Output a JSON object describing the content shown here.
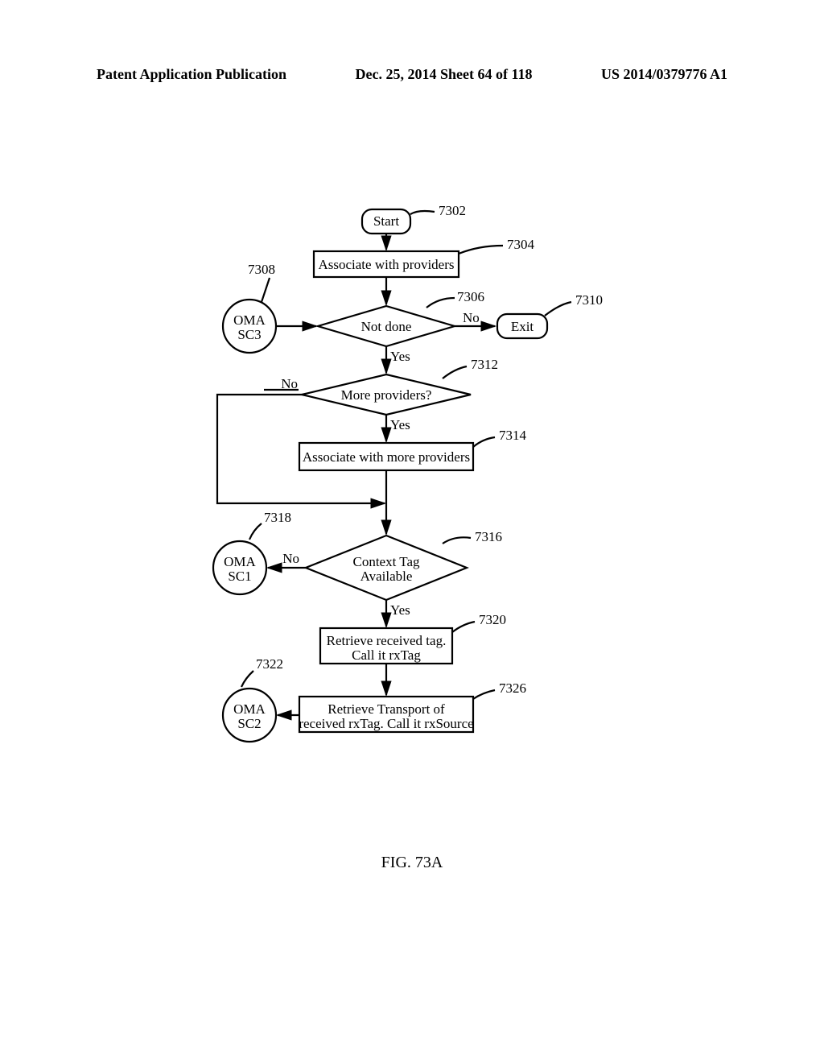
{
  "header": {
    "left": "Patent Application Publication",
    "center": "Dec. 25, 2014  Sheet 64 of 118",
    "right": "US 2014/0379776 A1"
  },
  "figure": {
    "caption": "FIG. 73A"
  },
  "nodes": {
    "start": {
      "label": "Start",
      "ref": "7302"
    },
    "assoc": {
      "label": "Associate with providers",
      "ref": "7304"
    },
    "oma_sc3": {
      "line1": "OMA",
      "line2": "SC3",
      "ref": "7308"
    },
    "notdone": {
      "label": "Not done",
      "ref": "7306",
      "yes": "Yes",
      "no": "No"
    },
    "exit": {
      "label": "Exit",
      "ref": "7310"
    },
    "more": {
      "label": "More providers?",
      "ref": "7312",
      "yes": "Yes",
      "no": "No"
    },
    "assoc_more": {
      "label": "Associate with more providers",
      "ref": "7314"
    },
    "oma_sc1": {
      "line1": "OMA",
      "line2": "SC1",
      "ref": "7318"
    },
    "ctx": {
      "line1": "Context Tag",
      "line2": "Available",
      "ref": "7316",
      "yes": "Yes",
      "no": "No"
    },
    "retrieve_tag": {
      "line1": "Retrieve received tag.",
      "line2": "Call it rxTag",
      "ref": "7320"
    },
    "oma_sc2": {
      "line1": "OMA",
      "line2": "SC2",
      "ref": "7322"
    },
    "retrieve_transport": {
      "line1": "Retrieve Transport of",
      "line2": "received rxTag.  Call it rxSource",
      "ref": "7326"
    }
  }
}
